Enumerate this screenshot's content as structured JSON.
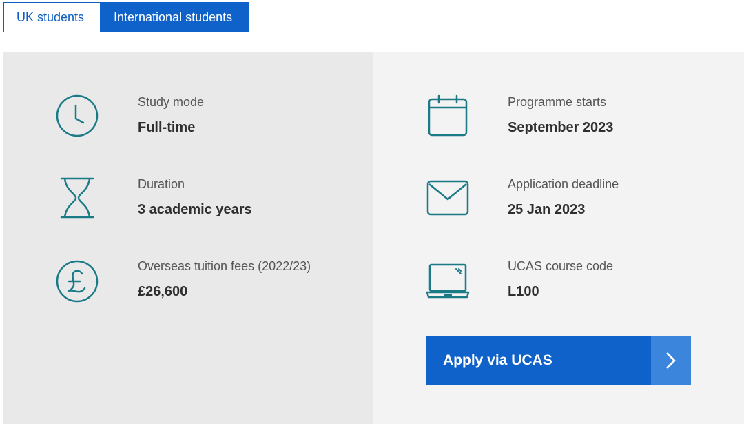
{
  "tabs": {
    "uk_label": "UK students",
    "international_label": "International students"
  },
  "left_items": [
    {
      "icon": "clock-icon",
      "label": "Study mode",
      "value": "Full-time"
    },
    {
      "icon": "hourglass-icon",
      "label": "Duration",
      "value": "3 academic years"
    },
    {
      "icon": "pound-icon",
      "label": "Overseas tuition fees (2022/23)",
      "value": "£26,600"
    }
  ],
  "right_items": [
    {
      "icon": "calendar-icon",
      "label": "Programme starts",
      "value": "September 2023"
    },
    {
      "icon": "envelope-icon",
      "label": "Application deadline",
      "value": "25 Jan 2023"
    },
    {
      "icon": "laptop-icon",
      "label": "UCAS course code",
      "value": "L100"
    }
  ],
  "apply": {
    "label": "Apply via UCAS",
    "icon": "chevron-right-icon"
  },
  "colors": {
    "accent": "#0f62c9",
    "icon": "#1a7a86",
    "left_bg": "#e9e9e9",
    "right_bg": "#f3f3f3"
  }
}
